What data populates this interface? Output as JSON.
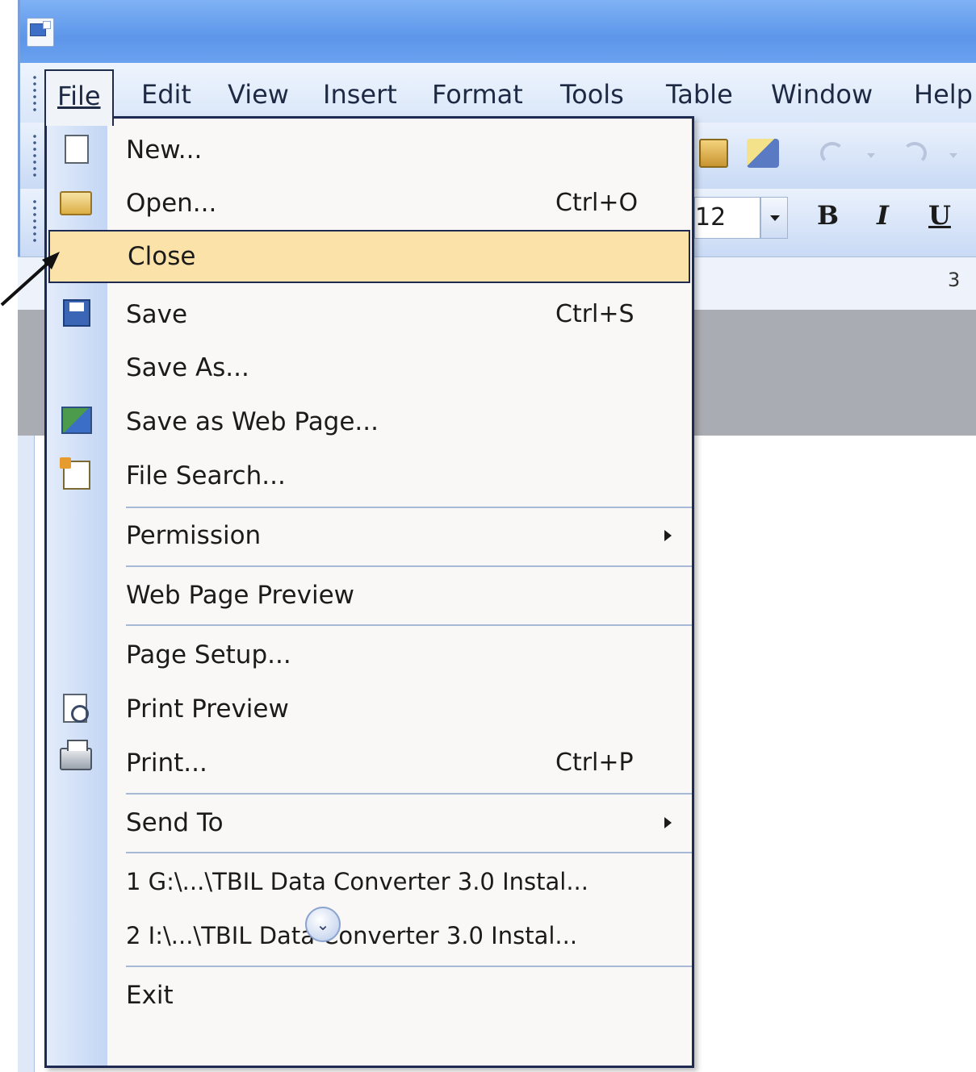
{
  "menubar": {
    "items": [
      "File",
      "Edit",
      "View",
      "Insert",
      "Format",
      "Tools",
      "Table",
      "Window",
      "Help"
    ],
    "active": "File"
  },
  "toolbar": {
    "font_size": "12",
    "bold": "B",
    "italic": "I",
    "underline": "U"
  },
  "ruler": {
    "mark": "3"
  },
  "file_menu": {
    "items": [
      {
        "label": "New...",
        "shortcut": "",
        "icon": "new-document-icon"
      },
      {
        "label": "Open...",
        "shortcut": "Ctrl+O",
        "icon": "open-folder-icon"
      },
      {
        "label": "Close",
        "shortcut": "",
        "icon": ""
      },
      {
        "label": "Save",
        "shortcut": "Ctrl+S",
        "icon": "save-disk-icon"
      },
      {
        "label": "Save As...",
        "shortcut": "",
        "icon": ""
      },
      {
        "label": "Save as Web Page...",
        "shortcut": "",
        "icon": "web-page-icon"
      },
      {
        "label": "File Search...",
        "shortcut": "",
        "icon": "file-search-icon"
      },
      {
        "label": "Permission",
        "shortcut": "",
        "icon": "",
        "submenu": true
      },
      {
        "label": "Web Page Preview",
        "shortcut": "",
        "icon": ""
      },
      {
        "label": "Page Setup...",
        "shortcut": "",
        "icon": ""
      },
      {
        "label": "Print Preview",
        "shortcut": "",
        "icon": "print-preview-icon"
      },
      {
        "label": "Print...",
        "shortcut": "Ctrl+P",
        "icon": "printer-icon"
      },
      {
        "label": "Send To",
        "shortcut": "",
        "icon": "",
        "submenu": true
      },
      {
        "label": "1 G:\\...\\TBIL Data Converter 3.0 Instal...",
        "shortcut": "",
        "icon": ""
      },
      {
        "label": "2 I:\\...\\TBIL Data Converter 3.0 Instal...",
        "shortcut": "",
        "icon": ""
      },
      {
        "label": "Exit",
        "shortcut": "",
        "icon": ""
      }
    ],
    "highlighted": "Close",
    "highlight_color": "#fbe2a8"
  }
}
